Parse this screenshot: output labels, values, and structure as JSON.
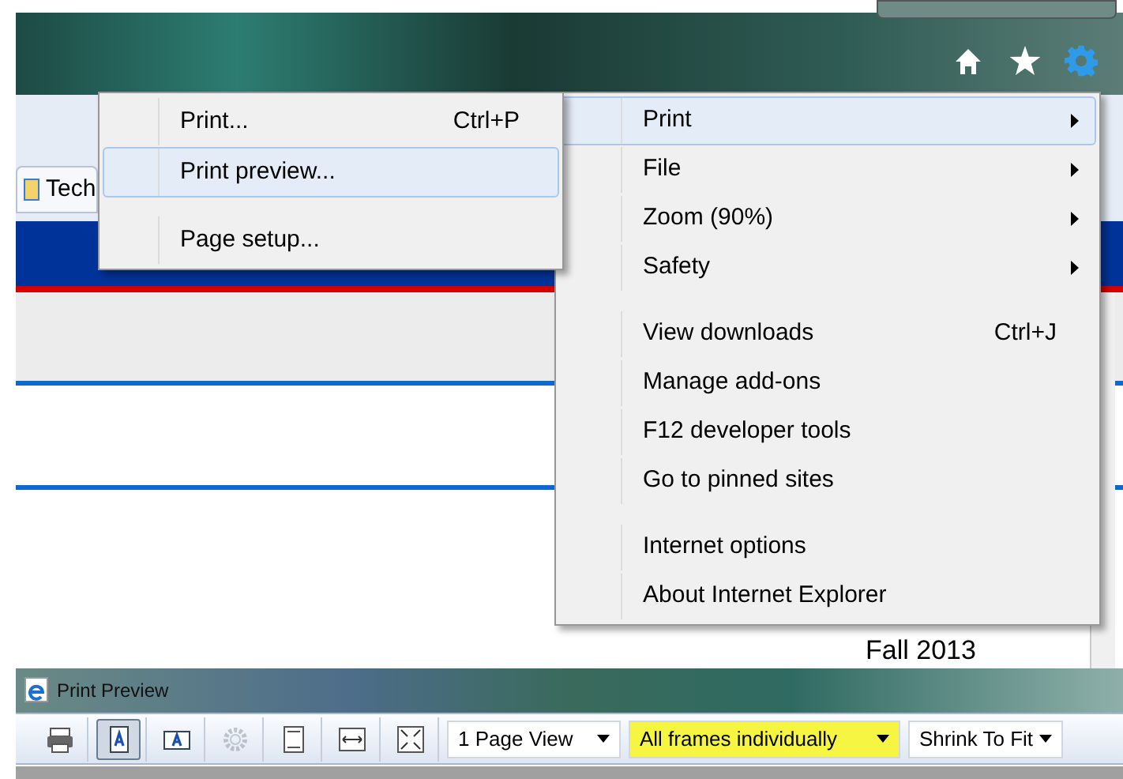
{
  "browser": {
    "tab": {
      "label": "Tech"
    },
    "page_text": "Fall 2013"
  },
  "tools_menu": {
    "items": [
      {
        "kind": "item",
        "label": "Print",
        "submenu": true,
        "selected": true
      },
      {
        "kind": "item",
        "label": "File",
        "submenu": true,
        "selected": false
      },
      {
        "kind": "item",
        "label": "Zoom (90%)",
        "submenu": true,
        "selected": false
      },
      {
        "kind": "item",
        "label": "Safety",
        "submenu": true,
        "selected": false
      },
      {
        "kind": "separator"
      },
      {
        "kind": "item",
        "label": "View downloads",
        "shortcut": "Ctrl+J",
        "submenu": false,
        "selected": false
      },
      {
        "kind": "item",
        "label": "Manage add-ons",
        "submenu": false,
        "selected": false
      },
      {
        "kind": "item",
        "label": "F12 developer tools",
        "submenu": false,
        "selected": false
      },
      {
        "kind": "item",
        "label": "Go to pinned sites",
        "submenu": false,
        "selected": false
      },
      {
        "kind": "separator"
      },
      {
        "kind": "item",
        "label": "Internet options",
        "submenu": false,
        "selected": false
      },
      {
        "kind": "item",
        "label": "About Internet Explorer",
        "submenu": false,
        "selected": false
      }
    ]
  },
  "print_submenu": {
    "items": [
      {
        "kind": "item",
        "label": "Print...",
        "shortcut": "Ctrl+P",
        "selected": false
      },
      {
        "kind": "item",
        "label": "Print preview...",
        "selected": true
      },
      {
        "kind": "separator"
      },
      {
        "kind": "item",
        "label": "Page setup...",
        "selected": false
      }
    ]
  },
  "print_preview": {
    "title": "Print Preview",
    "toolbar": [
      {
        "kind": "print",
        "pressed": false,
        "disabled": false
      },
      {
        "kind": "portrait",
        "pressed": true,
        "disabled": false
      },
      {
        "kind": "landscape",
        "pressed": false,
        "disabled": false
      },
      {
        "kind": "gear",
        "pressed": false,
        "disabled": true
      },
      {
        "kind": "header",
        "pressed": false,
        "disabled": false
      },
      {
        "kind": "width",
        "pressed": false,
        "disabled": false
      },
      {
        "kind": "fullpage",
        "pressed": false,
        "disabled": false
      }
    ],
    "dropdowns": [
      {
        "value": "1 Page View",
        "highlighted": false
      },
      {
        "value": "All frames individually",
        "highlighted": true
      },
      {
        "value": "Shrink To Fit",
        "highlighted": false
      }
    ]
  }
}
